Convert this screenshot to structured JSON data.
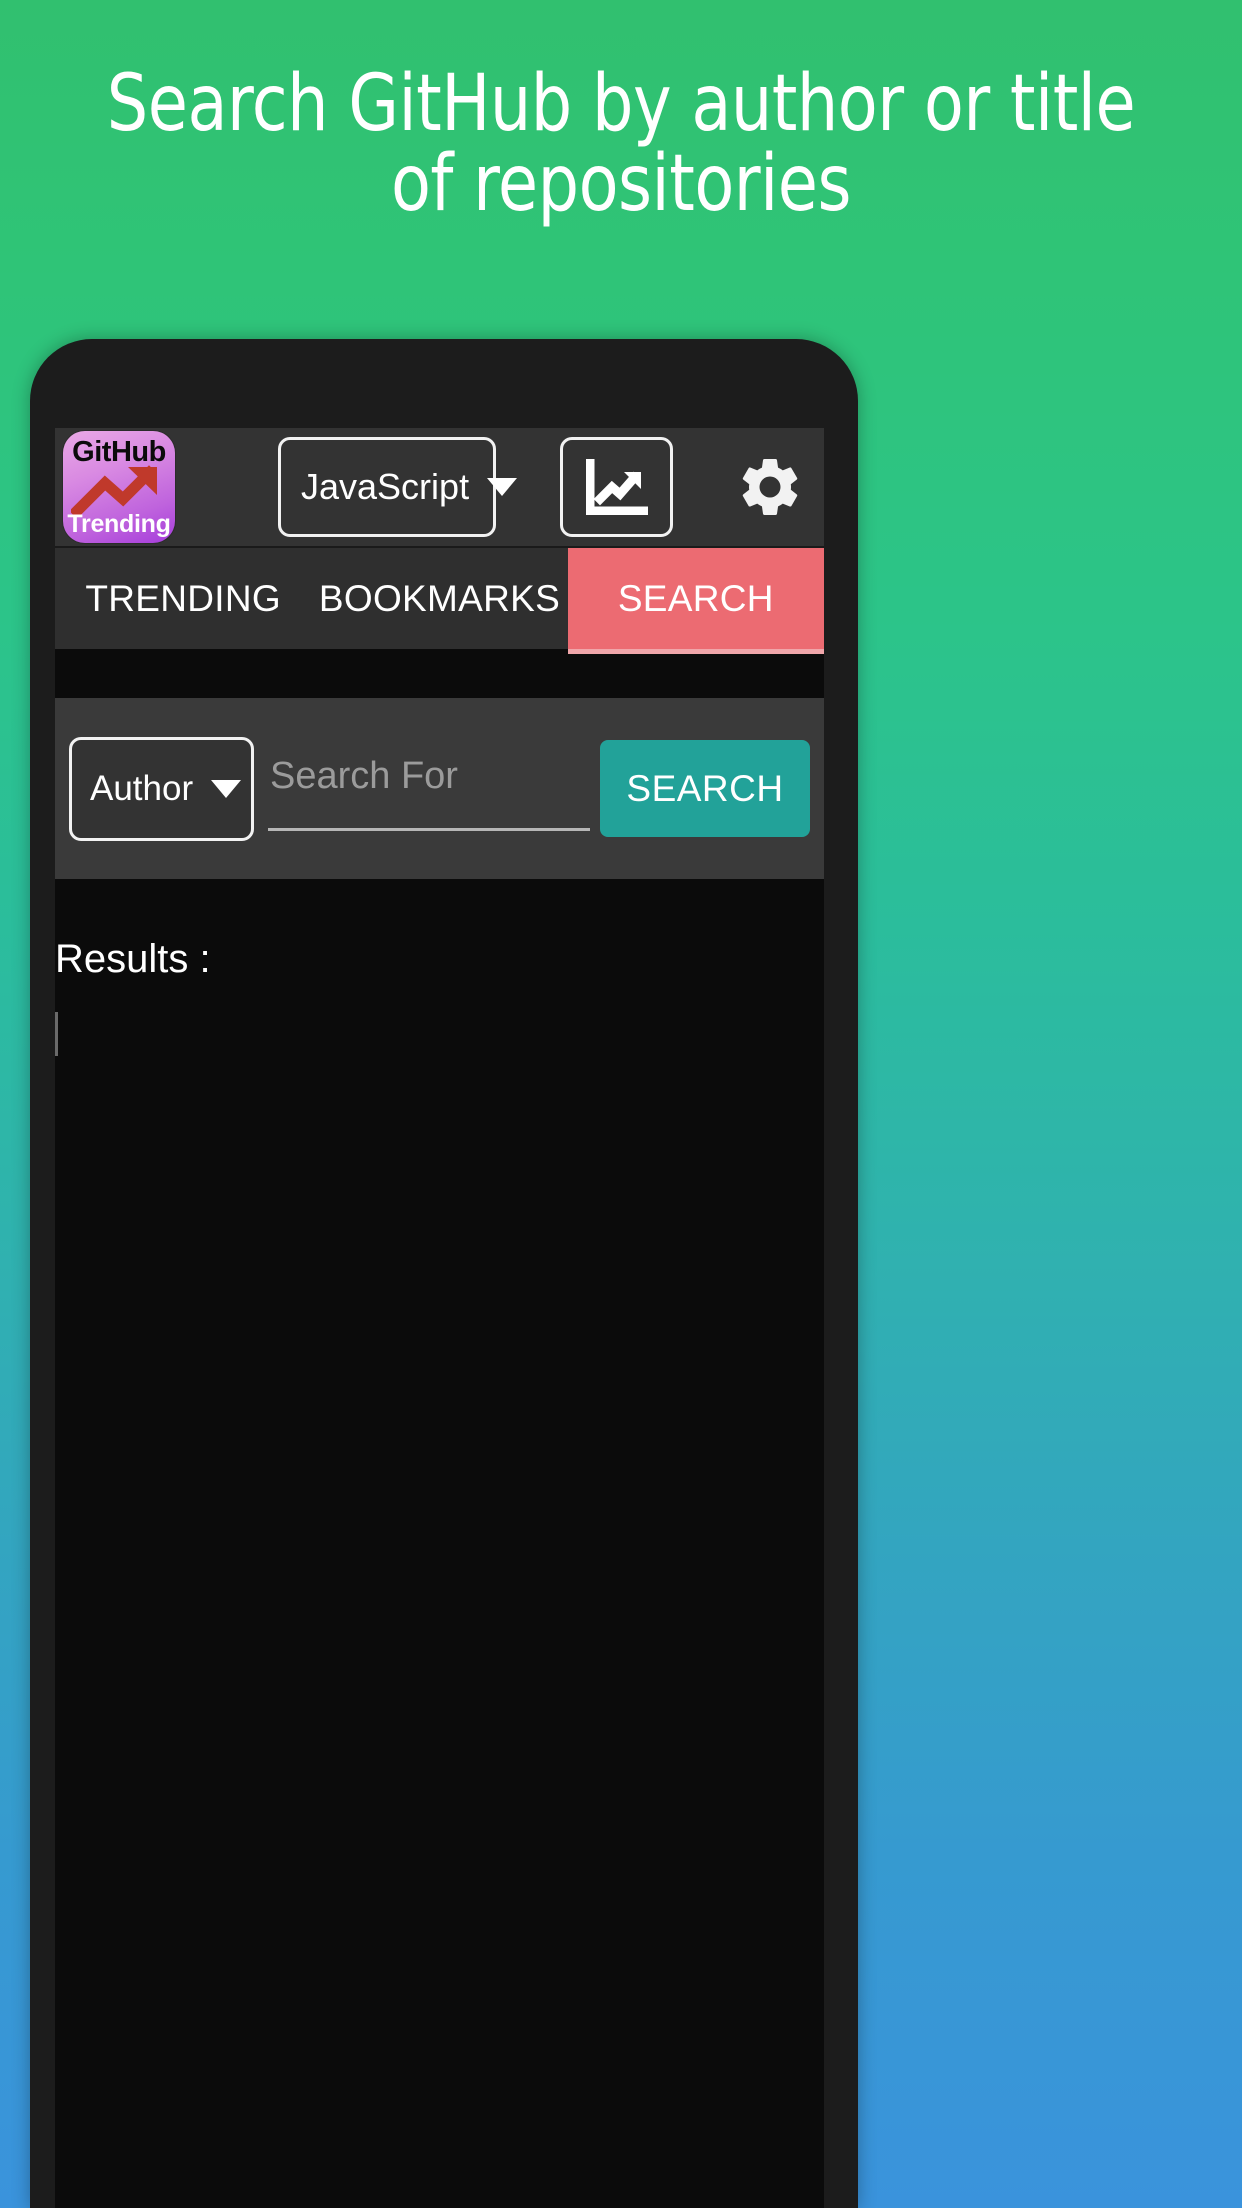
{
  "promo": {
    "headline_line1": "Search GitHub by author or title",
    "headline_line2": "of repositories",
    "bg_gradient_top": "#31c06f",
    "bg_gradient_bottom": "#3a93dc"
  },
  "app": {
    "toolbar": {
      "logo": {
        "top_text": "GitHub",
        "bottom_text": "Trending",
        "icon": "trending-arrow-icon",
        "gradient_start": "#e9a9e6",
        "gradient_end": "#a63ddb",
        "arrow_color": "#c0392b"
      },
      "language_dropdown": {
        "value": "JavaScript",
        "caret": "chevron-down-icon"
      },
      "chart_button": {
        "icon": "line-chart-icon"
      },
      "settings_button": {
        "icon": "gear-icon"
      }
    },
    "tabs": [
      {
        "label": "TRENDING",
        "active": false
      },
      {
        "label": "BOOKMARKS",
        "active": false
      },
      {
        "label": "SEARCH",
        "active": true
      }
    ],
    "tab_active_color": "#ec6b72",
    "search": {
      "type_dropdown": {
        "value": "Author",
        "caret": "chevron-down-icon"
      },
      "query_input": {
        "value": "",
        "placeholder": "Search For"
      },
      "submit_button": {
        "label": "SEARCH",
        "color": "#22a299"
      }
    },
    "results": {
      "label": "Results :"
    }
  }
}
